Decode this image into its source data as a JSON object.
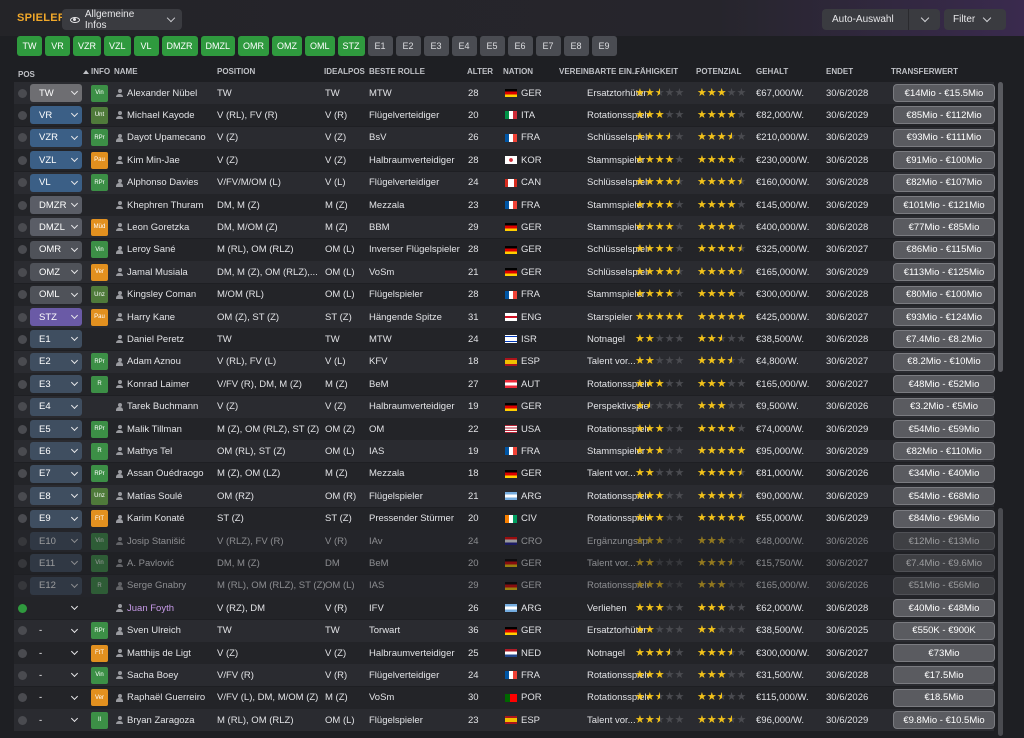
{
  "header": {
    "title": "SPIELER",
    "view_label": "Allgemeine Infos",
    "auto_label": "Auto-Auswahl",
    "filter_label": "Filter"
  },
  "position_filters": [
    {
      "label": "TW",
      "on": true
    },
    {
      "label": "VR",
      "on": true
    },
    {
      "label": "VZR",
      "on": true
    },
    {
      "label": "VZL",
      "on": true
    },
    {
      "label": "VL",
      "on": true
    },
    {
      "label": "DMZR",
      "on": true
    },
    {
      "label": "DMZL",
      "on": true
    },
    {
      "label": "OMR",
      "on": true
    },
    {
      "label": "OMZ",
      "on": true
    },
    {
      "label": "OML",
      "on": true
    },
    {
      "label": "STZ",
      "on": true
    },
    {
      "label": "E1",
      "on": false
    },
    {
      "label": "E2",
      "on": false
    },
    {
      "label": "E3",
      "on": false
    },
    {
      "label": "E4",
      "on": false
    },
    {
      "label": "E5",
      "on": false
    },
    {
      "label": "E6",
      "on": false
    },
    {
      "label": "E7",
      "on": false
    },
    {
      "label": "E8",
      "on": false
    },
    {
      "label": "E9",
      "on": false
    }
  ],
  "columns": {
    "pos": "POS",
    "info": "INFO",
    "name": "NAME",
    "position": "POSITION",
    "ideal": "IDEALPOS",
    "role": "BESTE ROLLE",
    "age": "ALTER",
    "nat": "NATION",
    "status": "VEREINBARTE EIN...",
    "cur": "FÄHIGKEIT",
    "pot": "POTENZIAL",
    "wage": "GEHALT",
    "ends": "ENDET",
    "value": "TRANSFERWERT"
  },
  "colors": {
    "accent": "#f0a82a",
    "on": "#2f9a3e",
    "star": "#f2c21a",
    "loan": "#c79ae8"
  },
  "players": [
    {
      "pos": "TW",
      "pc": "gk",
      "badge": "Vin",
      "bc": "green",
      "name": "Alexander Nübel",
      "position": "TW",
      "ideal": "TW",
      "role": "MTW",
      "age": "28",
      "nat": "GER",
      "flag": "ger",
      "status": "Ersatztorhüter",
      "cur": 2.5,
      "pot": 3,
      "wage": "€67,000/W.",
      "ends": "30/6/2028",
      "value": "€14Mio - €15.5Mio"
    },
    {
      "pos": "VR",
      "pc": "def",
      "badge": "Unt",
      "bc": "olive",
      "name": "Michael Kayode",
      "position": "V (RL), FV (R)",
      "ideal": "V (R)",
      "role": "Flügelverteidiger",
      "age": "20",
      "nat": "ITA",
      "flag": "ita",
      "status": "Rotationsspieler",
      "cur": 3,
      "pot": 4,
      "wage": "€82,000/W.",
      "ends": "30/6/2029",
      "value": "€85Mio - €112Mio"
    },
    {
      "pos": "VZR",
      "pc": "def",
      "badge": "RPr",
      "bc": "green",
      "name": "Dayot Upamecano",
      "position": "V (Z)",
      "ideal": "V (Z)",
      "role": "BsV",
      "age": "26",
      "nat": "FRA",
      "flag": "fra",
      "status": "Schlüsselspieler",
      "cur": 3.5,
      "pot": 3.5,
      "wage": "€210,000/W.",
      "ends": "30/6/2029",
      "value": "€93Mio - €111Mio"
    },
    {
      "pos": "VZL",
      "pc": "def",
      "badge": "Pau",
      "bc": "orange",
      "name": "Kim Min-Jae",
      "position": "V (Z)",
      "ideal": "V (Z)",
      "role": "Halbraumverteidiger",
      "age": "28",
      "nat": "KOR",
      "flag": "kor",
      "status": "Stammspieler",
      "cur": 4,
      "pot": 4,
      "wage": "€230,000/W.",
      "ends": "30/6/2028",
      "value": "€91Mio - €100Mio"
    },
    {
      "pos": "VL",
      "pc": "def",
      "badge": "RPr",
      "bc": "green",
      "name": "Alphonso Davies",
      "position": "V/FV/M/OM (L)",
      "ideal": "V (L)",
      "role": "Flügelverteidiger",
      "age": "24",
      "nat": "CAN",
      "flag": "can",
      "status": "Schlüsselspieler",
      "cur": 4.5,
      "pot": 4.5,
      "wage": "€160,000/W.",
      "ends": "30/6/2028",
      "value": "€82Mio - €107Mio"
    },
    {
      "pos": "DMZR",
      "pc": "dm",
      "badge": "",
      "bc": "",
      "name": "Khephren Thuram",
      "position": "DM, M (Z)",
      "ideal": "M (Z)",
      "role": "Mezzala",
      "age": "23",
      "nat": "FRA",
      "flag": "fra",
      "status": "Stammspieler",
      "cur": 4,
      "pot": 4,
      "wage": "€145,000/W.",
      "ends": "30/6/2029",
      "value": "€101Mio - €121Mio"
    },
    {
      "pos": "DMZL",
      "pc": "dm",
      "badge": "Müd",
      "bc": "orange",
      "name": "Leon Goretzka",
      "position": "DM, M/OM (Z)",
      "ideal": "M (Z)",
      "role": "BBM",
      "age": "29",
      "nat": "GER",
      "flag": "ger",
      "status": "Stammspieler",
      "cur": 4,
      "pot": 4,
      "wage": "€400,000/W.",
      "ends": "30/6/2028",
      "value": "€77Mio - €85Mio"
    },
    {
      "pos": "OMR",
      "pc": "mid",
      "badge": "Vin",
      "bc": "green",
      "name": "Leroy Sané",
      "position": "M (RL), OM (RLZ)",
      "ideal": "OM (L)",
      "role": "Inverser Flügelspieler",
      "age": "28",
      "nat": "GER",
      "flag": "ger",
      "status": "Schlüsselspieler",
      "cur": 4,
      "pot": 4.5,
      "wage": "€325,000/W.",
      "ends": "30/6/2027",
      "value": "€86Mio - €115Mio"
    },
    {
      "pos": "OMZ",
      "pc": "mid",
      "badge": "Ver",
      "bc": "orange",
      "name": "Jamal Musiala",
      "position": "DM, M (Z), OM (RLZ),...",
      "ideal": "OM (L)",
      "role": "VoSm",
      "age": "21",
      "nat": "GER",
      "flag": "ger",
      "status": "Schlüsselspieler",
      "cur": 4.5,
      "pot": 4.5,
      "wage": "€165,000/W.",
      "ends": "30/6/2029",
      "value": "€113Mio - €125Mio"
    },
    {
      "pos": "OML",
      "pc": "mid",
      "badge": "Unz",
      "bc": "olive",
      "name": "Kingsley Coman",
      "position": "M/OM (RL)",
      "ideal": "OM (L)",
      "role": "Flügelspieler",
      "age": "28",
      "nat": "FRA",
      "flag": "fra",
      "status": "Stammspieler",
      "cur": 4,
      "pot": 4,
      "wage": "€300,000/W.",
      "ends": "30/6/2028",
      "value": "€80Mio - €100Mio"
    },
    {
      "pos": "STZ",
      "pc": "st",
      "badge": "Pau",
      "bc": "orange",
      "name": "Harry Kane",
      "position": "OM (Z), ST (Z)",
      "ideal": "ST (Z)",
      "role": "Hängende Spitze",
      "age": "31",
      "nat": "ENG",
      "flag": "eng",
      "status": "Starspieler",
      "cur": 5,
      "pot": 5,
      "wage": "€425,000/W.",
      "ends": "30/6/2027",
      "value": "€93Mio - €124Mio"
    },
    {
      "pos": "E1",
      "pc": "res",
      "badge": "",
      "bc": "",
      "name": "Daniel Peretz",
      "position": "TW",
      "ideal": "TW",
      "role": "MTW",
      "age": "24",
      "nat": "ISR",
      "flag": "isr",
      "status": "Notnagel",
      "cur": 2,
      "pot": 2.5,
      "wage": "€38,500/W.",
      "ends": "30/6/2028",
      "value": "€7.4Mio - €8.2Mio"
    },
    {
      "pos": "E2",
      "pc": "res",
      "badge": "RPr",
      "bc": "green",
      "name": "Adam Aznou",
      "position": "V (RL), FV (L)",
      "ideal": "V (L)",
      "role": "KFV",
      "age": "18",
      "nat": "ESP",
      "flag": "esp",
      "status": "Talent vor...",
      "cur": 2,
      "pot": 3.5,
      "wage": "€4,800/W.",
      "ends": "30/6/2027",
      "value": "€8.2Mio - €10Mio"
    },
    {
      "pos": "E3",
      "pc": "res",
      "badge": "R",
      "bc": "green",
      "name": "Konrad Laimer",
      "position": "V/FV (R), DM, M (Z)",
      "ideal": "M (Z)",
      "role": "BeM",
      "age": "27",
      "nat": "AUT",
      "flag": "aut",
      "status": "Rotationsspieler",
      "cur": 3,
      "pot": 3,
      "wage": "€165,000/W.",
      "ends": "30/6/2027",
      "value": "€48Mio - €52Mio"
    },
    {
      "pos": "E4",
      "pc": "res",
      "badge": "",
      "bc": "",
      "name": "Tarek Buchmann",
      "position": "V (Z)",
      "ideal": "V (Z)",
      "role": "Halbraumverteidiger",
      "age": "19",
      "nat": "GER",
      "flag": "ger",
      "status": "Perspektivspie...",
      "cur": 1.5,
      "pot": 3,
      "wage": "€9,500/W.",
      "ends": "30/6/2026",
      "value": "€3.2Mio - €5Mio"
    },
    {
      "pos": "E5",
      "pc": "res",
      "badge": "RPr",
      "bc": "green",
      "name": "Malik Tillman",
      "position": "M (Z), OM (RLZ), ST (Z)",
      "ideal": "OM (Z)",
      "role": "OM",
      "age": "22",
      "nat": "USA",
      "flag": "usa",
      "status": "Rotationsspieler",
      "cur": 3,
      "pot": 4,
      "wage": "€74,000/W.",
      "ends": "30/6/2029",
      "value": "€54Mio - €59Mio"
    },
    {
      "pos": "E6",
      "pc": "res",
      "badge": "R",
      "bc": "green",
      "name": "Mathys Tel",
      "position": "OM (RL), ST (Z)",
      "ideal": "OM (L)",
      "role": "IAS",
      "age": "19",
      "nat": "FRA",
      "flag": "fra",
      "status": "Stammspieler",
      "cur": 3,
      "pot": 5,
      "wage": "€95,000/W.",
      "ends": "30/6/2029",
      "value": "€82Mio - €110Mio"
    },
    {
      "pos": "E7",
      "pc": "res",
      "badge": "RPr",
      "bc": "green",
      "name": "Assan Ouédraogo",
      "position": "M (Z), OM (LZ)",
      "ideal": "M (Z)",
      "role": "Mezzala",
      "age": "18",
      "nat": "GER",
      "flag": "ger",
      "status": "Talent vor...",
      "cur": 2,
      "pot": 4.5,
      "wage": "€81,000/W.",
      "ends": "30/6/2026",
      "value": "€34Mio - €40Mio"
    },
    {
      "pos": "E8",
      "pc": "res",
      "badge": "Unz",
      "bc": "olive",
      "name": "Matías Soulé",
      "position": "OM (RZ)",
      "ideal": "OM (R)",
      "role": "Flügelspieler",
      "age": "21",
      "nat": "ARG",
      "flag": "arg",
      "status": "Rotationsspieler",
      "cur": 3,
      "pot": 4.5,
      "wage": "€90,000/W.",
      "ends": "30/6/2029",
      "value": "€54Mio - €68Mio"
    },
    {
      "pos": "E9",
      "pc": "res",
      "badge": "FtT",
      "bc": "orange",
      "name": "Karim Konaté",
      "position": "ST (Z)",
      "ideal": "ST (Z)",
      "role": "Pressender Stürmer",
      "age": "20",
      "nat": "CIV",
      "flag": "civ",
      "status": "Rotationsspieler",
      "cur": 3,
      "pot": 5,
      "wage": "€55,000/W.",
      "ends": "30/6/2029",
      "value": "€84Mio - €96Mio"
    },
    {
      "pos": "E10",
      "pc": "res",
      "dim": true,
      "badge": "Vin",
      "bc": "green",
      "name": "Josip Stanišić",
      "position": "V (RLZ), FV (R)",
      "ideal": "V (R)",
      "role": "IAv",
      "age": "24",
      "nat": "CRO",
      "flag": "cro",
      "status": "Ergänzungsspi...",
      "cur": 3,
      "pot": 3,
      "wage": "€48,000/W.",
      "ends": "30/6/2026",
      "value": "€12Mio - €13Mio"
    },
    {
      "pos": "E11",
      "pc": "res",
      "dim": true,
      "badge": "Vin",
      "bc": "green",
      "name": "A. Pavlović",
      "position": "DM, M (Z)",
      "ideal": "DM",
      "role": "BeM",
      "age": "20",
      "nat": "GER",
      "flag": "ger",
      "status": "Talent vor...",
      "cur": 2,
      "pot": 3.5,
      "wage": "€15,750/W.",
      "ends": "30/6/2027",
      "value": "€7.4Mio - €9.6Mio"
    },
    {
      "pos": "E12",
      "pc": "res",
      "dim": true,
      "badge": "R",
      "bc": "green",
      "name": "Serge Gnabry",
      "position": "M (RL), OM (RLZ), ST (Z)",
      "ideal": "OM (L)",
      "role": "IAS",
      "age": "29",
      "nat": "GER",
      "flag": "ger",
      "status": "Rotationsspieler",
      "cur": 3,
      "pot": 3,
      "wage": "€165,000/W.",
      "ends": "30/6/2026",
      "value": "€51Mio - €56Mio"
    },
    {
      "pos": "",
      "pc": "none",
      "check": true,
      "loan": true,
      "badge": "",
      "bc": "",
      "name": "Juan Foyth",
      "position": "V (RZ), DM",
      "ideal": "V (R)",
      "role": "IFV",
      "age": "26",
      "nat": "ARG",
      "flag": "arg",
      "status": "Verliehen",
      "cur": 3,
      "pot": 3,
      "wage": "€62,000/W.",
      "ends": "30/6/2028",
      "value": "€40Mio - €48Mio"
    },
    {
      "pos": "-",
      "pc": "none",
      "badge": "RPr",
      "bc": "green",
      "name": "Sven Ulreich",
      "position": "TW",
      "ideal": "TW",
      "role": "Torwart",
      "age": "36",
      "nat": "GER",
      "flag": "ger",
      "status": "Ersatztorhüter",
      "cur": 2,
      "pot": 2,
      "wage": "€38,500/W.",
      "ends": "30/6/2025",
      "value": "€550K - €900K"
    },
    {
      "pos": "-",
      "pc": "none",
      "badge": "FtT",
      "bc": "orange",
      "name": "Matthijs de Ligt",
      "position": "V (Z)",
      "ideal": "V (Z)",
      "role": "Halbraumverteidiger",
      "age": "25",
      "nat": "NED",
      "flag": "ned",
      "status": "Notnagel",
      "cur": 3.5,
      "pot": 3.5,
      "wage": "€300,000/W.",
      "ends": "30/6/2027",
      "value": "€73Mio"
    },
    {
      "pos": "-",
      "pc": "none",
      "badge": "Vin",
      "bc": "green",
      "name": "Sacha Boey",
      "position": "V/FV (R)",
      "ideal": "V (R)",
      "role": "Flügelverteidiger",
      "age": "24",
      "nat": "FRA",
      "flag": "fra",
      "status": "Rotationsspieler",
      "cur": 3,
      "pot": 3,
      "wage": "€31,500/W.",
      "ends": "30/6/2028",
      "value": "€17.5Mio"
    },
    {
      "pos": "-",
      "pc": "none",
      "badge": "Ver",
      "bc": "orange",
      "name": "Raphaël Guerreiro",
      "position": "V/FV (L), DM, M/OM (Z)",
      "ideal": "M (Z)",
      "role": "VoSm",
      "age": "30",
      "nat": "POR",
      "flag": "por",
      "status": "Rotationsspieler",
      "cur": 2.5,
      "pot": 2.5,
      "wage": "€115,000/W.",
      "ends": "30/6/2026",
      "value": "€18.5Mio"
    },
    {
      "pos": "-",
      "pc": "none",
      "badge": "Il",
      "bc": "green",
      "name": "Bryan Zaragoza",
      "position": "M (RL), OM (RLZ)",
      "ideal": "OM (L)",
      "role": "Flügelspieler",
      "age": "23",
      "nat": "ESP",
      "flag": "esp",
      "status": "Talent vor...",
      "cur": 2.5,
      "pot": 3.5,
      "wage": "€96,000/W.",
      "ends": "30/6/2029",
      "value": "€9.8Mio - €10.5Mio"
    }
  ]
}
